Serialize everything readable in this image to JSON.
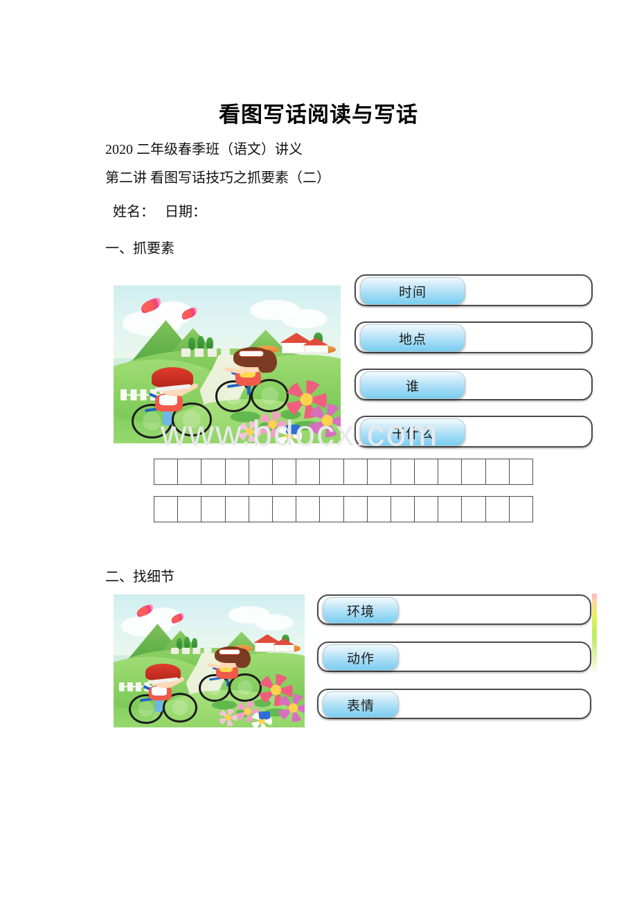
{
  "document": {
    "title": "看图写话阅读与写话",
    "course_line": "2020 二年级春季班（语文）讲义",
    "lesson_line": "第二讲 看图写话技巧之抓要素（二）",
    "name_date_line": " 姓名：   日期：",
    "watermark": "www.bdocx.com"
  },
  "sections": [
    {
      "heading": "一、抓要素",
      "image_alt": "两个小朋友在乡间小路上骑自行车的卡通插图",
      "rows": [
        {
          "label": "时间",
          "value": ""
        },
        {
          "label": "地点",
          "value": ""
        },
        {
          "label": "谁",
          "value": ""
        },
        {
          "label": "干什么",
          "value": ""
        }
      ],
      "writing_grid": {
        "rows": 2,
        "cells_per_row": 16,
        "values": []
      }
    },
    {
      "heading": "二、找细节",
      "image_alt": "两个小朋友在乡间小路上骑自行车的卡通插图",
      "rows": [
        {
          "label": "环境",
          "value": ""
        },
        {
          "label": "动作",
          "value": ""
        },
        {
          "label": "表情",
          "value": ""
        }
      ]
    }
  ],
  "colors": {
    "pill_top": "#f2fbfe",
    "pill_bottom": "#79cdf0",
    "row_border": "#4a4a4a",
    "grid_border": "#4d4d4d",
    "watermark": "#e9e9ec",
    "strip_pink": "#ffb3c8",
    "strip_green": "#bdea5e",
    "page_background": "#ffffff"
  },
  "illustration": {
    "sky": "#cfeef0",
    "grass": "#72c452",
    "path": "#f3f5e2",
    "roof": "#e04b3a",
    "helmet": "#e03c2d",
    "bike": "#1e63c8",
    "hair": "#7b3a22"
  }
}
